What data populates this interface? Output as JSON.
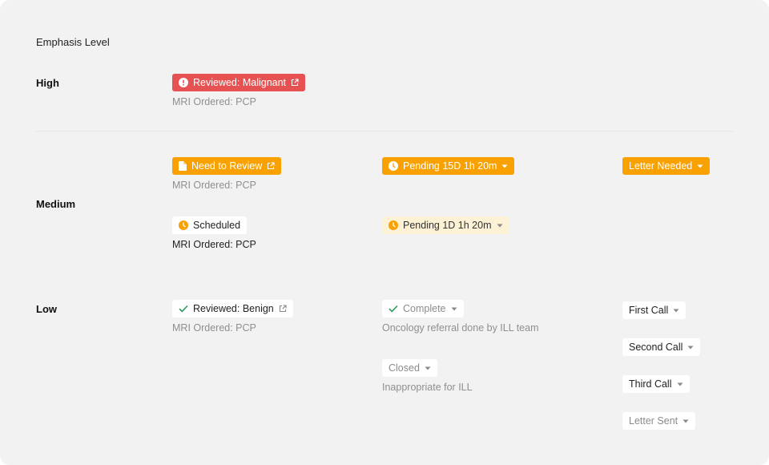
{
  "heading": "Emphasis Level",
  "levels": {
    "high": "High",
    "medium": "Medium",
    "low": "Low"
  },
  "high": {
    "chip": "Reviewed: Malignant",
    "sub": "MRI Ordered: PCP"
  },
  "medium": {
    "need_review": "Need to Review",
    "need_review_sub": "MRI Ordered: PCP",
    "pending_1": "Pending 15D 1h 20m",
    "letter_needed": "Letter Needed",
    "scheduled": "Scheduled",
    "scheduled_sub": "MRI Ordered: PCP",
    "pending_2": "Pending 1D 1h 20m"
  },
  "low": {
    "reviewed_benign": "Reviewed: Benign",
    "reviewed_benign_sub": "MRI Ordered: PCP",
    "complete": "Complete",
    "complete_sub": "Oncology referral done by ILL team",
    "closed": "Closed",
    "closed_sub": "Inappropriate for ILL",
    "first_call": "First Call",
    "second_call": "Second Call",
    "third_call": "Third Call",
    "letter_sent": "Letter Sent"
  },
  "icons": {
    "alert": "alert-circle-icon",
    "external": "external-link-icon",
    "document": "document-icon",
    "clock": "clock-icon",
    "check": "check-icon",
    "caret": "caret-down-icon"
  },
  "colors": {
    "red": "#e65252",
    "orange": "#f8a100",
    "cream": "#fdf1d6",
    "green_check": "#2e9a5a",
    "muted_text": "#8f8f8f"
  }
}
